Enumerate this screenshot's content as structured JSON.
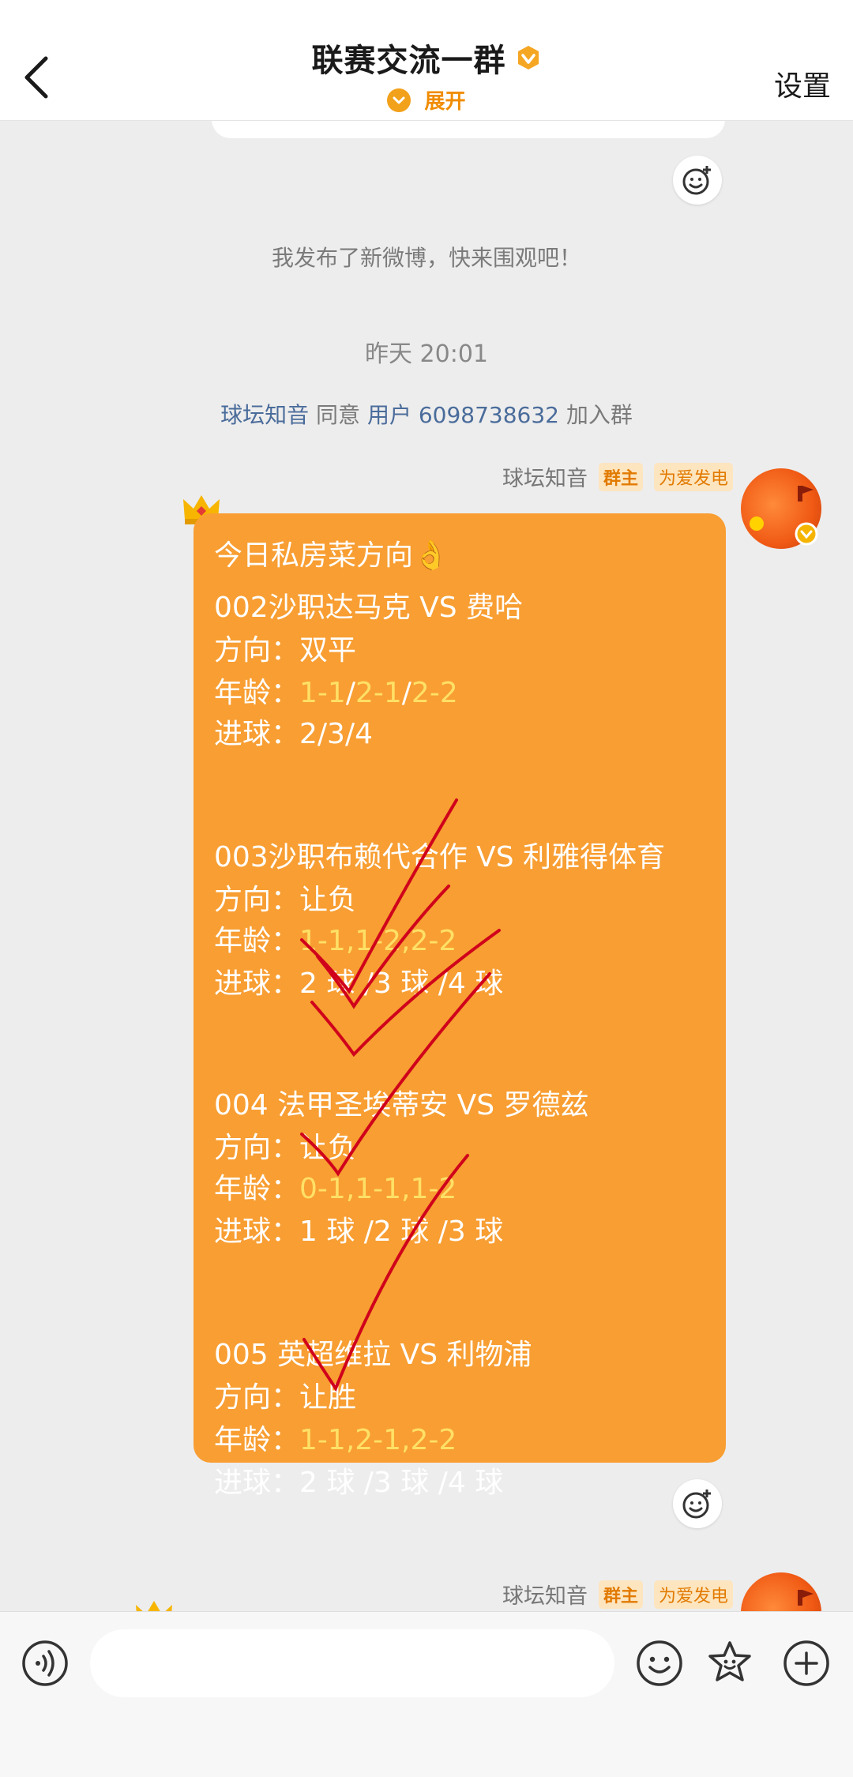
{
  "header": {
    "title": "联赛交流一群",
    "expand_label": "展开",
    "settings_label": "设置"
  },
  "chat": {
    "system_message": "我发布了新微博，快来围观吧！",
    "timestamp": "昨天 20:01",
    "join_notice": {
      "approver": "球坛知音",
      "verb": "同意",
      "user": "用户 6098738632",
      "suffix": "加入群"
    },
    "sender": {
      "name": "球坛知音",
      "role_badge": "群主",
      "fan_badge": "为爱发电"
    },
    "message_lines": [
      {
        "segments": [
          {
            "text": "今日私房菜方向👌"
          }
        ]
      },
      {
        "segments": [
          {
            "text": "002沙职达马克 VS 费哈"
          }
        ]
      },
      {
        "segments": [
          {
            "text": "方向：双平"
          }
        ]
      },
      {
        "segments": [
          {
            "text": "年龄："
          },
          {
            "text": "1-1",
            "hl": true
          },
          {
            "text": "/"
          },
          {
            "text": "2-1",
            "hl": true
          },
          {
            "text": "/"
          },
          {
            "text": "2-2",
            "hl": true
          }
        ]
      },
      {
        "segments": [
          {
            "text": "进球：2/3/4"
          }
        ]
      },
      {
        "segments": [
          {
            "text": "003沙职布赖代合作 VS 利雅得体育"
          }
        ]
      },
      {
        "segments": [
          {
            "text": "方向：让负"
          }
        ]
      },
      {
        "segments": [
          {
            "text": "年龄："
          },
          {
            "text": "1-1,1-2,2-2",
            "hl": true
          }
        ]
      },
      {
        "segments": [
          {
            "text": "进球：2 球 /3 球 /4 球"
          }
        ]
      },
      {
        "segments": [
          {
            "text": "004 法甲圣埃蒂安 VS 罗德兹"
          }
        ]
      },
      {
        "segments": [
          {
            "text": "方向：让负"
          }
        ]
      },
      {
        "segments": [
          {
            "text": "年龄："
          },
          {
            "text": "0-1,1-1,1-2",
            "hl": true
          }
        ]
      },
      {
        "segments": [
          {
            "text": "进球：1 球 /2 球 /3 球"
          }
        ]
      },
      {
        "segments": [
          {
            "text": "005 英超维拉 VS 利物浦"
          }
        ]
      },
      {
        "segments": [
          {
            "text": "方向：让胜"
          }
        ]
      },
      {
        "segments": [
          {
            "text": "年龄："
          },
          {
            "text": "1-1,2-1,2-2",
            "hl": true
          }
        ]
      },
      {
        "segments": [
          {
            "text": "进球：2 球 /3 球 /4 球"
          }
        ]
      }
    ]
  },
  "bottom_bar": {
    "input_placeholder": "",
    "icons": [
      "voice-icon",
      "emoji-icon",
      "sticker-icon",
      "plus-icon"
    ]
  },
  "colors": {
    "bubble": "#f89e32",
    "highlight": "#ffe066",
    "accent": "#f08c00",
    "link": "#4a6c9b",
    "check_mark": "#d0021b"
  },
  "icons": {
    "back": "chevron-left-icon",
    "verified": "verified-badge-icon",
    "expand": "chevron-down-icon",
    "react": "add-reaction-icon",
    "crown": "crown-icon"
  }
}
